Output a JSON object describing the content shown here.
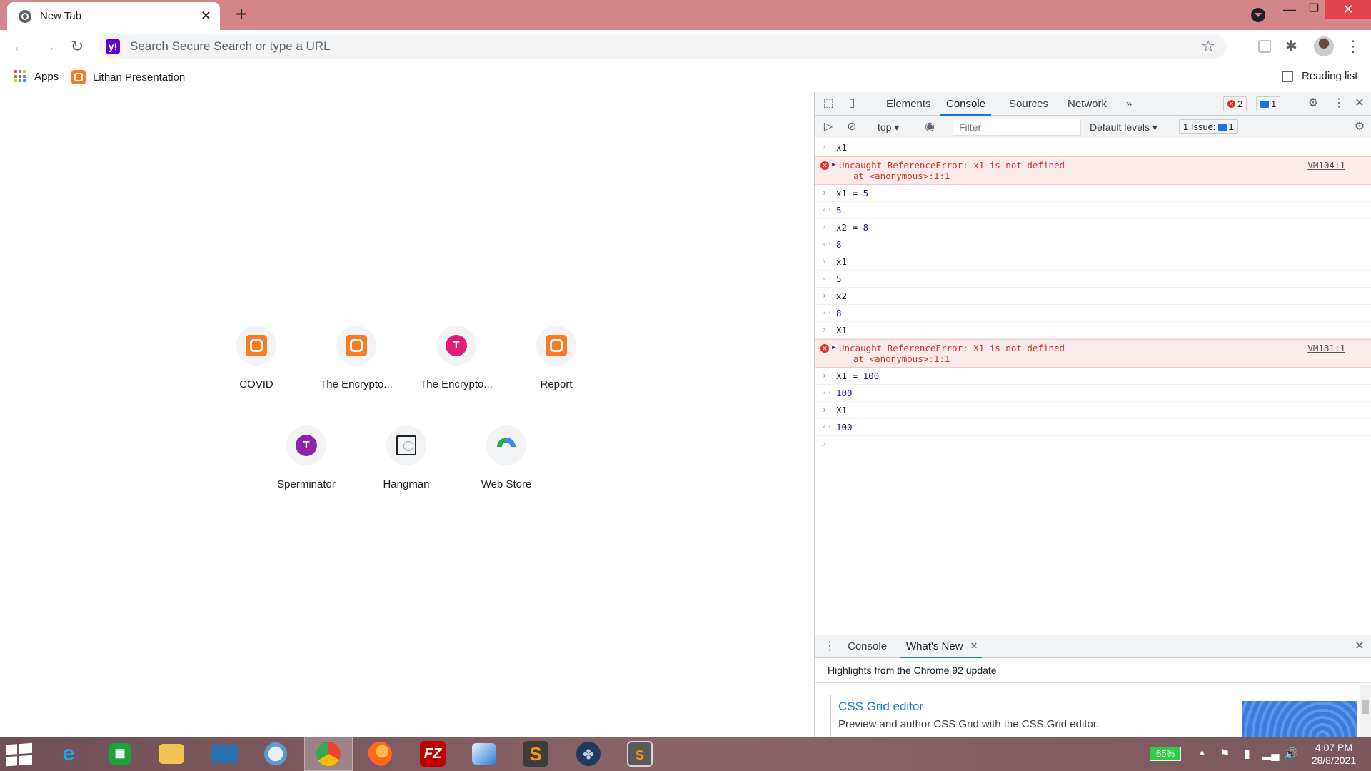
{
  "browser": {
    "tab_title": "New Tab",
    "omnibox_placeholder": "Search Secure Search or type a URL",
    "bookmarks": [
      {
        "label": "Apps",
        "icon": "apps-grid-icon"
      },
      {
        "label": "Lithan Presentation",
        "icon": "xampp-icon"
      }
    ],
    "reading_list": "Reading list"
  },
  "ntp": {
    "shortcuts": [
      {
        "label": "COVID",
        "icon": "xampp-icon"
      },
      {
        "label": "The Encrypto...",
        "icon": "xampp-icon"
      },
      {
        "label": "The Encrypto...",
        "icon": "letter-icon",
        "letter": "T",
        "color": "#e31c79"
      },
      {
        "label": "Report",
        "icon": "xampp-icon"
      },
      {
        "label": "Sperminator",
        "icon": "letter-icon",
        "letter": "T",
        "color": "#8e24aa"
      },
      {
        "label": "Hangman",
        "icon": "hangman-icon"
      },
      {
        "label": "Web Store",
        "icon": "webstore-icon"
      }
    ]
  },
  "devtools": {
    "tabs": [
      "Elements",
      "Console",
      "Sources",
      "Network"
    ],
    "more_tabs": "»",
    "error_count": "2",
    "info_count": "1",
    "context": "top",
    "filter_placeholder": "Filter",
    "levels": "Default levels",
    "issues_label": "1 Issue:",
    "issues_count": "1",
    "console": [
      {
        "type": "input",
        "text": "x1"
      },
      {
        "type": "error",
        "text": "Uncaught ReferenceError: x1 is not defined",
        "at": "at <anonymous>:1:1",
        "source": "VM104:1"
      },
      {
        "type": "input",
        "var": "x1",
        "op": " = ",
        "num": "5"
      },
      {
        "type": "output",
        "text": "5"
      },
      {
        "type": "input",
        "var": "x2",
        "op": " = ",
        "num": "8"
      },
      {
        "type": "output",
        "text": "8"
      },
      {
        "type": "input",
        "text": "x1"
      },
      {
        "type": "output",
        "text": "5"
      },
      {
        "type": "input",
        "text": "x2"
      },
      {
        "type": "output",
        "text": "8"
      },
      {
        "type": "input",
        "text": "X1"
      },
      {
        "type": "error",
        "text": "Uncaught ReferenceError: X1 is not defined",
        "at": "at <anonymous>:1:1",
        "source": "VM181:1"
      },
      {
        "type": "input",
        "var": "X1",
        "op": " = ",
        "num": "100"
      },
      {
        "type": "output",
        "text": "100"
      },
      {
        "type": "input",
        "text": "X1"
      },
      {
        "type": "output",
        "text": "100"
      }
    ],
    "drawer": {
      "tabs": [
        "Console",
        "What's New"
      ],
      "highlights": "Highlights from the Chrome 92 update",
      "card_title": "CSS Grid editor",
      "card_desc": "Preview and author CSS Grid with the CSS Grid editor."
    }
  },
  "taskbar": {
    "battery": "65%",
    "time": "4:07 PM",
    "date": "28/8/2021",
    "apps": [
      "internet-explorer",
      "store",
      "file-explorer",
      "remote-desktop",
      "safari",
      "chrome",
      "firefox",
      "filezilla",
      "sublime-ink",
      "sublime-text",
      "tree-app",
      "sublime-s"
    ]
  }
}
